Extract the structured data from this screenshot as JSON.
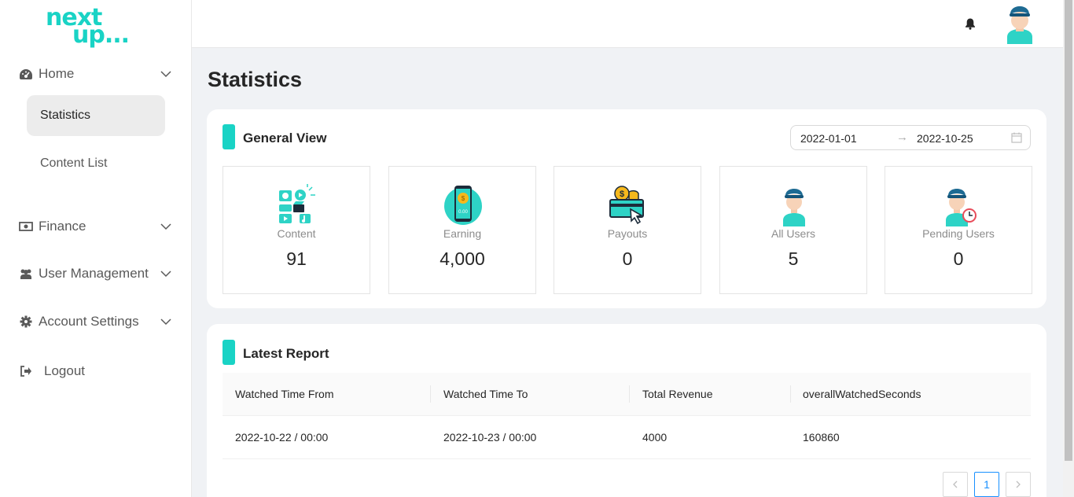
{
  "brand": {
    "line1": "next",
    "line2": "up..."
  },
  "sidebar": {
    "home": {
      "label": "Home",
      "icon": "dashboard-icon"
    },
    "statistics": {
      "label": "Statistics"
    },
    "content_list": {
      "label": "Content List"
    },
    "finance": {
      "label": "Finance",
      "icon": "money-icon"
    },
    "user_management": {
      "label": "User Management",
      "icon": "users-icon"
    },
    "account_settings": {
      "label": "Account Settings",
      "icon": "gear-icon"
    },
    "logout": {
      "label": "Logout",
      "icon": "logout-icon"
    }
  },
  "header": {
    "bell_icon": "bell-icon",
    "avatar": "user-avatar"
  },
  "page": {
    "title": "Statistics"
  },
  "general_view": {
    "title": "General View",
    "date_from": "2022-01-01",
    "date_to": "2022-10-25",
    "stats": [
      {
        "label": "Content",
        "value": "91",
        "icon": "content-icon"
      },
      {
        "label": "Earning",
        "value": "4,000",
        "icon": "earning-icon"
      },
      {
        "label": "Payouts",
        "value": "0",
        "icon": "payouts-icon"
      },
      {
        "label": "All Users",
        "value": "5",
        "icon": "users-icon"
      },
      {
        "label": "Pending Users",
        "value": "0",
        "icon": "pending-users-icon"
      }
    ]
  },
  "latest_report": {
    "title": "Latest Report",
    "columns": [
      "Watched Time From",
      "Watched Time To",
      "Total Revenue",
      "overallWatchedSeconds"
    ],
    "rows": [
      [
        "2022-10-22 / 00:00",
        "2022-10-23 / 00:00",
        "4000",
        "160860"
      ]
    ],
    "pagination": {
      "current": "1"
    }
  },
  "colors": {
    "accent": "#19d3c5",
    "active_page": "#1890ff"
  }
}
